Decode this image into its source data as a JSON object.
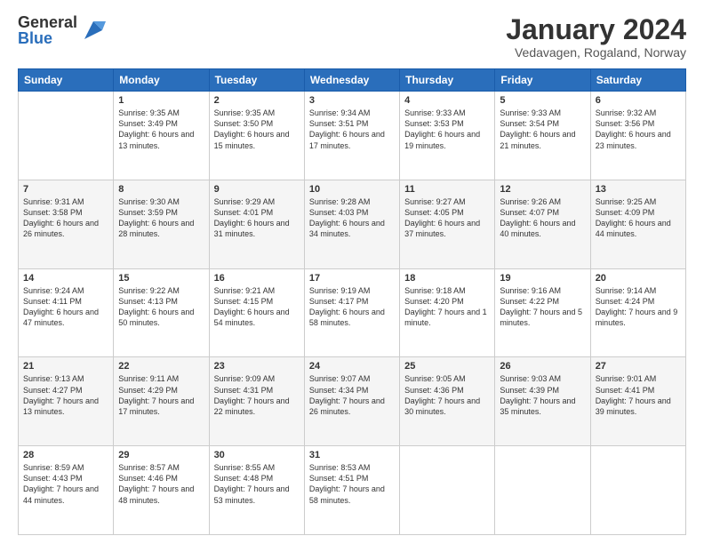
{
  "logo": {
    "general": "General",
    "blue": "Blue"
  },
  "header": {
    "title": "January 2024",
    "location": "Vedavagen, Rogaland, Norway"
  },
  "weekdays": [
    "Sunday",
    "Monday",
    "Tuesday",
    "Wednesday",
    "Thursday",
    "Friday",
    "Saturday"
  ],
  "weeks": [
    [
      {
        "day": "",
        "sunrise": "",
        "sunset": "",
        "daylight": ""
      },
      {
        "day": "1",
        "sunrise": "Sunrise: 9:35 AM",
        "sunset": "Sunset: 3:49 PM",
        "daylight": "Daylight: 6 hours and 13 minutes."
      },
      {
        "day": "2",
        "sunrise": "Sunrise: 9:35 AM",
        "sunset": "Sunset: 3:50 PM",
        "daylight": "Daylight: 6 hours and 15 minutes."
      },
      {
        "day": "3",
        "sunrise": "Sunrise: 9:34 AM",
        "sunset": "Sunset: 3:51 PM",
        "daylight": "Daylight: 6 hours and 17 minutes."
      },
      {
        "day": "4",
        "sunrise": "Sunrise: 9:33 AM",
        "sunset": "Sunset: 3:53 PM",
        "daylight": "Daylight: 6 hours and 19 minutes."
      },
      {
        "day": "5",
        "sunrise": "Sunrise: 9:33 AM",
        "sunset": "Sunset: 3:54 PM",
        "daylight": "Daylight: 6 hours and 21 minutes."
      },
      {
        "day": "6",
        "sunrise": "Sunrise: 9:32 AM",
        "sunset": "Sunset: 3:56 PM",
        "daylight": "Daylight: 6 hours and 23 minutes."
      }
    ],
    [
      {
        "day": "7",
        "sunrise": "Sunrise: 9:31 AM",
        "sunset": "Sunset: 3:58 PM",
        "daylight": "Daylight: 6 hours and 26 minutes."
      },
      {
        "day": "8",
        "sunrise": "Sunrise: 9:30 AM",
        "sunset": "Sunset: 3:59 PM",
        "daylight": "Daylight: 6 hours and 28 minutes."
      },
      {
        "day": "9",
        "sunrise": "Sunrise: 9:29 AM",
        "sunset": "Sunset: 4:01 PM",
        "daylight": "Daylight: 6 hours and 31 minutes."
      },
      {
        "day": "10",
        "sunrise": "Sunrise: 9:28 AM",
        "sunset": "Sunset: 4:03 PM",
        "daylight": "Daylight: 6 hours and 34 minutes."
      },
      {
        "day": "11",
        "sunrise": "Sunrise: 9:27 AM",
        "sunset": "Sunset: 4:05 PM",
        "daylight": "Daylight: 6 hours and 37 minutes."
      },
      {
        "day": "12",
        "sunrise": "Sunrise: 9:26 AM",
        "sunset": "Sunset: 4:07 PM",
        "daylight": "Daylight: 6 hours and 40 minutes."
      },
      {
        "day": "13",
        "sunrise": "Sunrise: 9:25 AM",
        "sunset": "Sunset: 4:09 PM",
        "daylight": "Daylight: 6 hours and 44 minutes."
      }
    ],
    [
      {
        "day": "14",
        "sunrise": "Sunrise: 9:24 AM",
        "sunset": "Sunset: 4:11 PM",
        "daylight": "Daylight: 6 hours and 47 minutes."
      },
      {
        "day": "15",
        "sunrise": "Sunrise: 9:22 AM",
        "sunset": "Sunset: 4:13 PM",
        "daylight": "Daylight: 6 hours and 50 minutes."
      },
      {
        "day": "16",
        "sunrise": "Sunrise: 9:21 AM",
        "sunset": "Sunset: 4:15 PM",
        "daylight": "Daylight: 6 hours and 54 minutes."
      },
      {
        "day": "17",
        "sunrise": "Sunrise: 9:19 AM",
        "sunset": "Sunset: 4:17 PM",
        "daylight": "Daylight: 6 hours and 58 minutes."
      },
      {
        "day": "18",
        "sunrise": "Sunrise: 9:18 AM",
        "sunset": "Sunset: 4:20 PM",
        "daylight": "Daylight: 7 hours and 1 minute."
      },
      {
        "day": "19",
        "sunrise": "Sunrise: 9:16 AM",
        "sunset": "Sunset: 4:22 PM",
        "daylight": "Daylight: 7 hours and 5 minutes."
      },
      {
        "day": "20",
        "sunrise": "Sunrise: 9:14 AM",
        "sunset": "Sunset: 4:24 PM",
        "daylight": "Daylight: 7 hours and 9 minutes."
      }
    ],
    [
      {
        "day": "21",
        "sunrise": "Sunrise: 9:13 AM",
        "sunset": "Sunset: 4:27 PM",
        "daylight": "Daylight: 7 hours and 13 minutes."
      },
      {
        "day": "22",
        "sunrise": "Sunrise: 9:11 AM",
        "sunset": "Sunset: 4:29 PM",
        "daylight": "Daylight: 7 hours and 17 minutes."
      },
      {
        "day": "23",
        "sunrise": "Sunrise: 9:09 AM",
        "sunset": "Sunset: 4:31 PM",
        "daylight": "Daylight: 7 hours and 22 minutes."
      },
      {
        "day": "24",
        "sunrise": "Sunrise: 9:07 AM",
        "sunset": "Sunset: 4:34 PM",
        "daylight": "Daylight: 7 hours and 26 minutes."
      },
      {
        "day": "25",
        "sunrise": "Sunrise: 9:05 AM",
        "sunset": "Sunset: 4:36 PM",
        "daylight": "Daylight: 7 hours and 30 minutes."
      },
      {
        "day": "26",
        "sunrise": "Sunrise: 9:03 AM",
        "sunset": "Sunset: 4:39 PM",
        "daylight": "Daylight: 7 hours and 35 minutes."
      },
      {
        "day": "27",
        "sunrise": "Sunrise: 9:01 AM",
        "sunset": "Sunset: 4:41 PM",
        "daylight": "Daylight: 7 hours and 39 minutes."
      }
    ],
    [
      {
        "day": "28",
        "sunrise": "Sunrise: 8:59 AM",
        "sunset": "Sunset: 4:43 PM",
        "daylight": "Daylight: 7 hours and 44 minutes."
      },
      {
        "day": "29",
        "sunrise": "Sunrise: 8:57 AM",
        "sunset": "Sunset: 4:46 PM",
        "daylight": "Daylight: 7 hours and 48 minutes."
      },
      {
        "day": "30",
        "sunrise": "Sunrise: 8:55 AM",
        "sunset": "Sunset: 4:48 PM",
        "daylight": "Daylight: 7 hours and 53 minutes."
      },
      {
        "day": "31",
        "sunrise": "Sunrise: 8:53 AM",
        "sunset": "Sunset: 4:51 PM",
        "daylight": "Daylight: 7 hours and 58 minutes."
      },
      {
        "day": "",
        "sunrise": "",
        "sunset": "",
        "daylight": ""
      },
      {
        "day": "",
        "sunrise": "",
        "sunset": "",
        "daylight": ""
      },
      {
        "day": "",
        "sunrise": "",
        "sunset": "",
        "daylight": ""
      }
    ]
  ]
}
